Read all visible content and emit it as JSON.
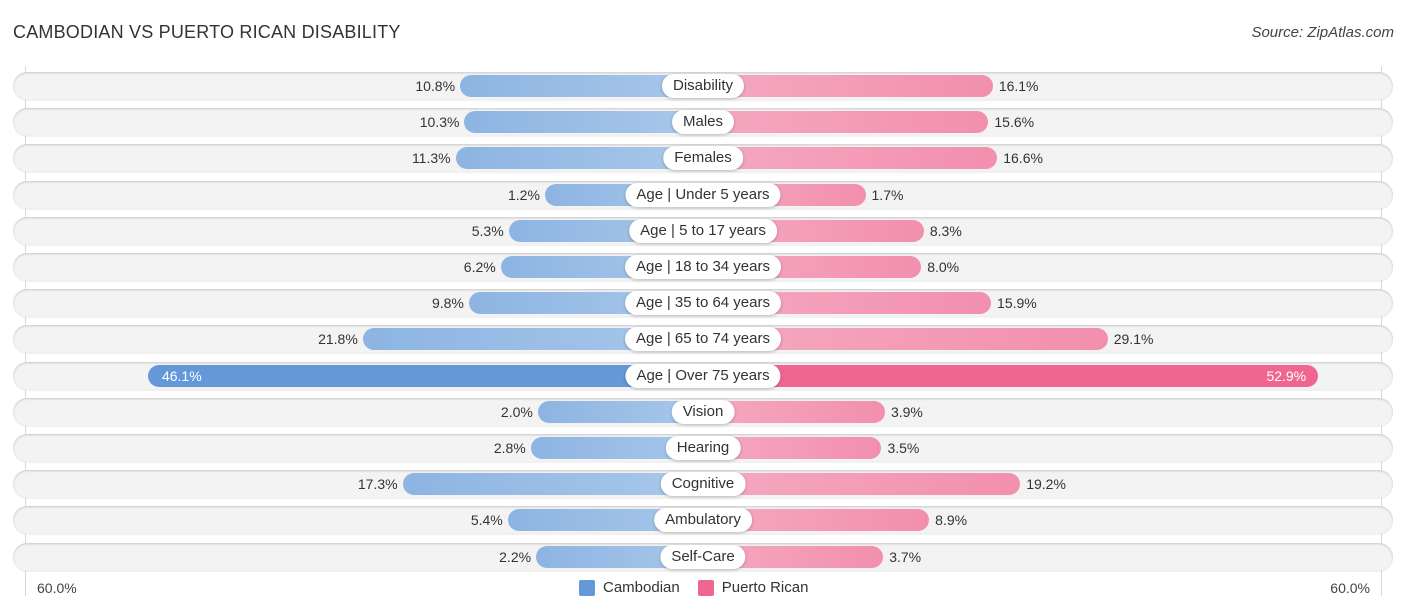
{
  "header": {
    "title": "CAMBODIAN VS PUERTO RICAN DISABILITY",
    "source": "Source: ZipAtlas.com"
  },
  "colors": {
    "cambodian": "#6399d8",
    "puerto_rican": "#ef6791"
  },
  "chart_data": {
    "type": "bar",
    "orientation": "horizontal-diverging",
    "title": "CAMBODIAN VS PUERTO RICAN DISABILITY",
    "categories": [
      "Disability",
      "Males",
      "Females",
      "Age | Under 5 years",
      "Age | 5 to 17 years",
      "Age | 18 to 34 years",
      "Age | 35 to 64 years",
      "Age | 65 to 74 years",
      "Age | Over 75 years",
      "Vision",
      "Hearing",
      "Cognitive",
      "Ambulatory",
      "Self-Care"
    ],
    "series": [
      {
        "name": "Cambodian",
        "side": "left",
        "values": [
          10.8,
          10.3,
          11.3,
          1.2,
          5.3,
          6.2,
          9.8,
          21.8,
          46.1,
          2.0,
          2.8,
          17.3,
          5.4,
          2.2
        ],
        "labels": [
          "10.8%",
          "10.3%",
          "11.3%",
          "1.2%",
          "5.3%",
          "6.2%",
          "9.8%",
          "21.8%",
          "46.1%",
          "2.0%",
          "2.8%",
          "17.3%",
          "5.4%",
          "2.2%"
        ]
      },
      {
        "name": "Puerto Rican",
        "side": "right",
        "values": [
          16.1,
          15.6,
          16.6,
          1.7,
          8.3,
          8.0,
          15.9,
          29.1,
          52.9,
          3.9,
          3.5,
          19.2,
          8.9,
          3.7
        ],
        "labels": [
          "16.1%",
          "15.6%",
          "16.6%",
          "1.7%",
          "8.3%",
          "8.0%",
          "15.9%",
          "29.1%",
          "52.9%",
          "3.9%",
          "3.5%",
          "19.2%",
          "8.9%",
          "3.7%"
        ]
      }
    ],
    "axis": {
      "min_label": "60.0%",
      "max_label": "60.0%",
      "max": 60.0
    },
    "legend": {
      "position": "bottom-center",
      "entries": [
        "Cambodian",
        "Puerto Rican"
      ]
    },
    "grid": false
  }
}
